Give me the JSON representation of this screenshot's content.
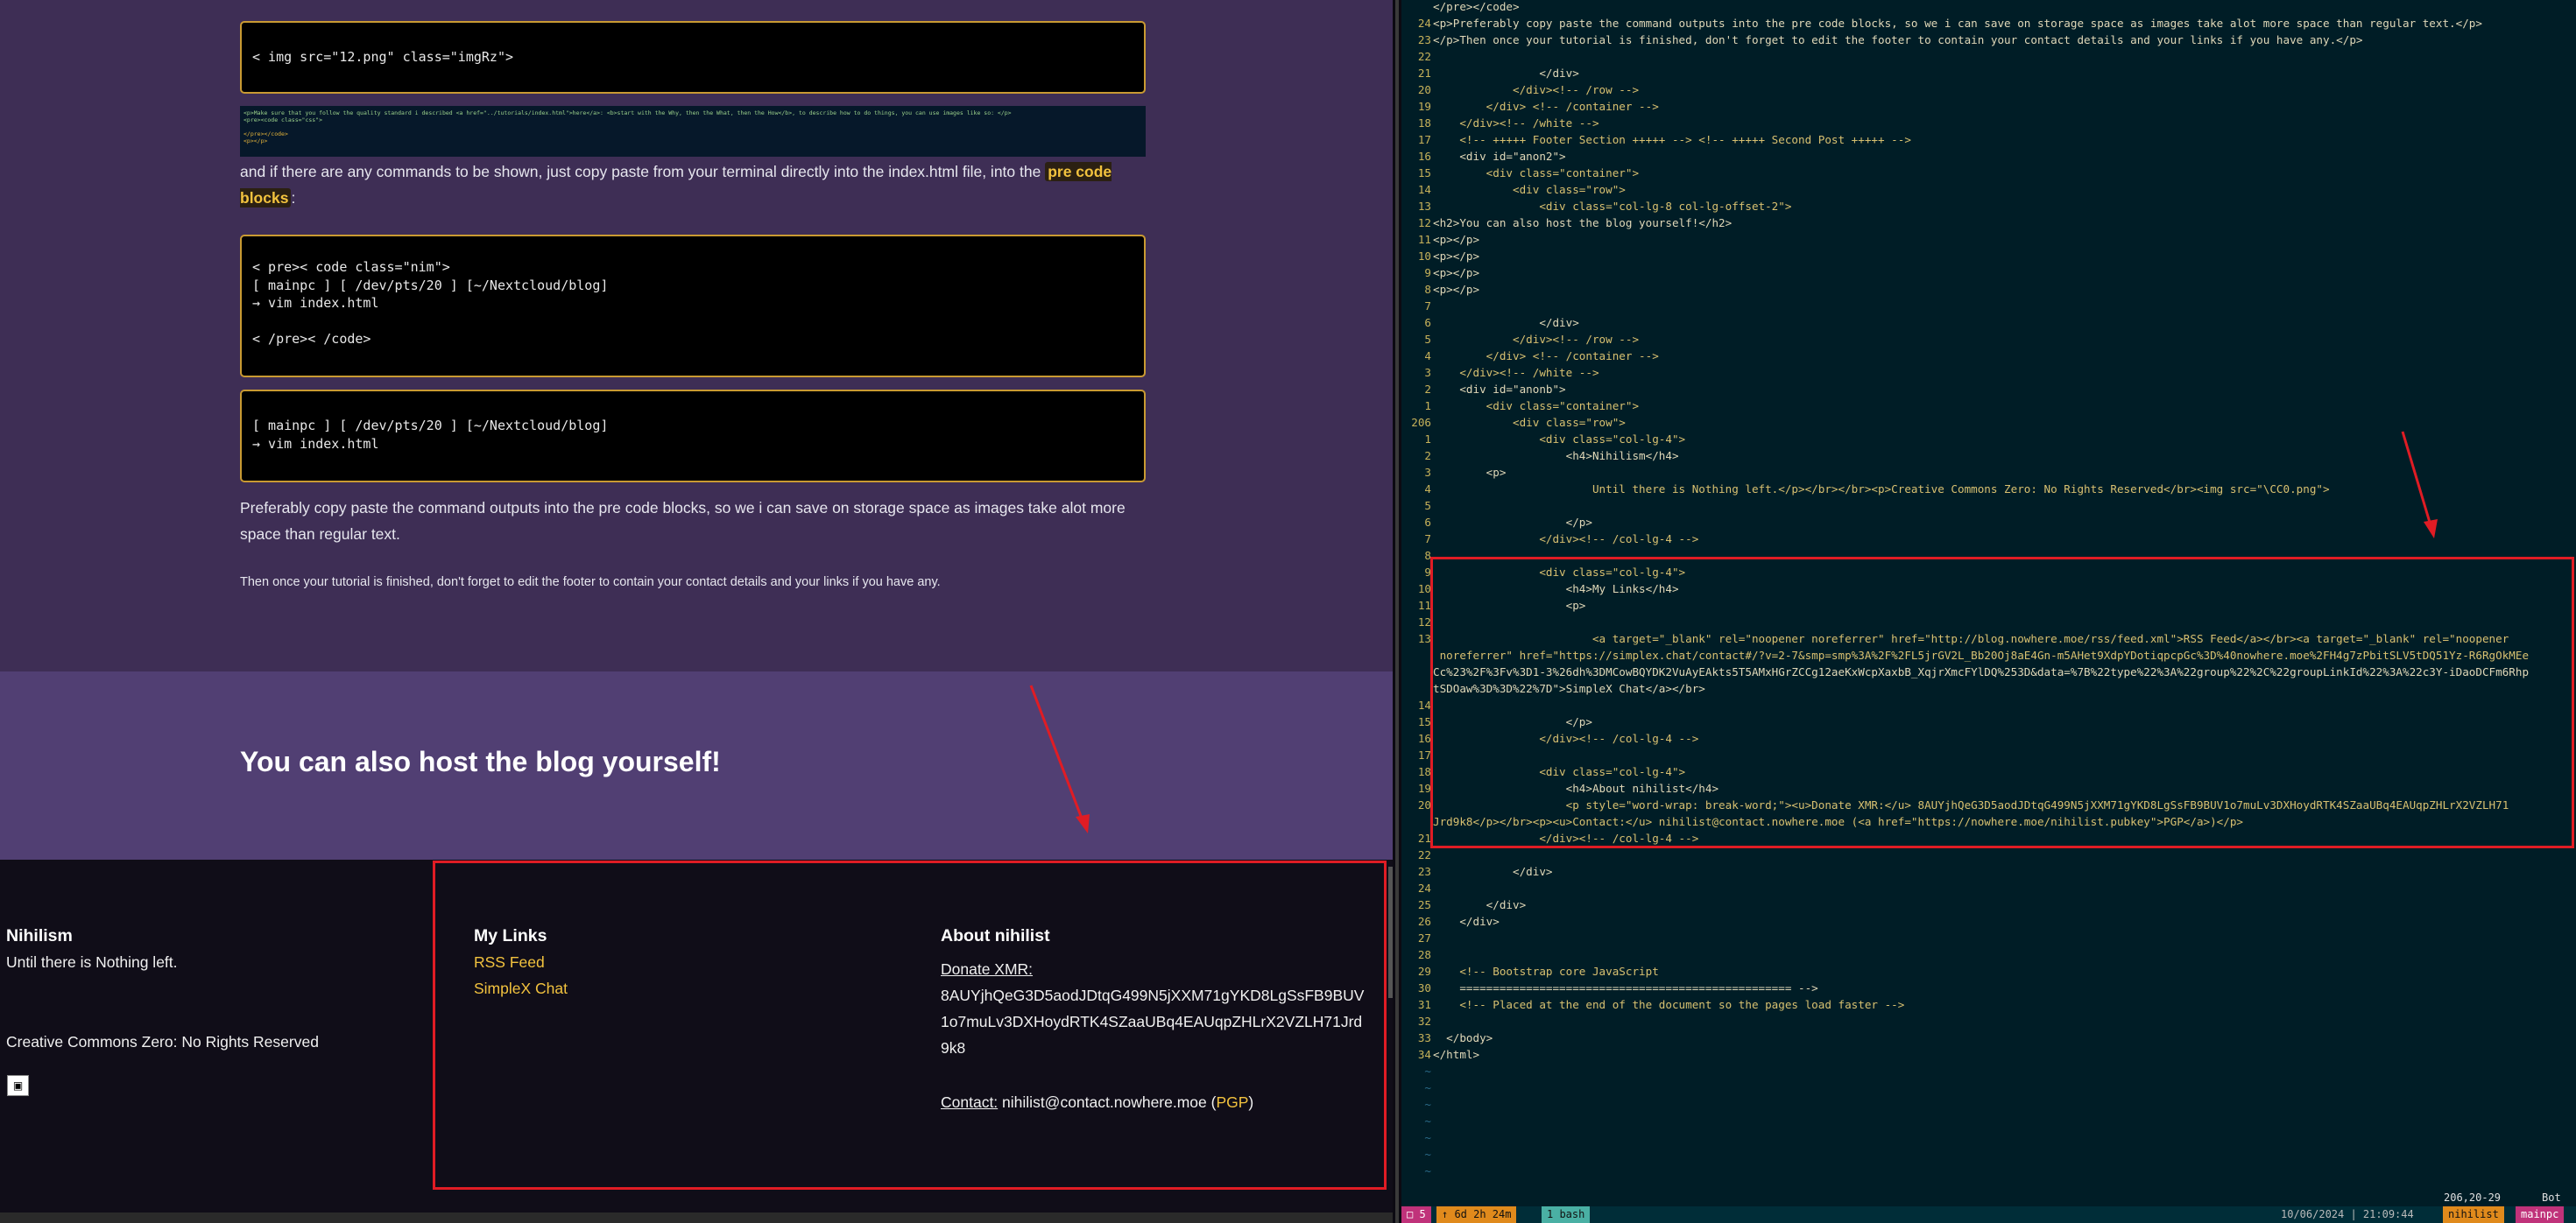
{
  "browser": {
    "code1": "< img src=\"12.png\" class=\"imgRz\">",
    "thumb_line1": "<p>Make sure that you follow the quality standard i described <a href=\"../tutorials/index.html\">here</a>: <b>start with the Why, then the What, then the How</b>, to describe how to do things, you can use images like so: </p>",
    "thumb_line2": "<pre><code class=\"css\">",
    "thumb_line3": "</pre></code>",
    "thumb_line4": "<p></p>",
    "para1_pre": "and if there are any commands to be shown, just copy paste from your terminal directly into the index.html file, into the ",
    "para1_hl": "pre code blocks",
    "para1_post": ":",
    "code2": "< pre>< code class=\"nim\">\n[ mainpc ] [ /dev/pts/20 ] [~/Nextcloud/blog]\n→ vim index.html\n\n< /pre>< /code>",
    "code3": "[ mainpc ] [ /dev/pts/20 ] [~/Nextcloud/blog]\n→ vim index.html",
    "para2": "Preferably copy paste the command outputs into the pre code blocks, so we i can save on storage space as images take alot more space than regular text.",
    "para3": "Then once your tutorial is finished, don't forget to edit the footer to contain your contact details and your links if you have any.",
    "section_title": "You can also host the blog yourself!",
    "footer": {
      "col1_title": "Nihilism",
      "col1_text": "Until there is Nothing left.",
      "col1_license": "Creative Commons Zero: No Rights Reserved",
      "col2_title": "My Links",
      "link_rss": "RSS Feed",
      "link_simplex": "SimpleX Chat",
      "col3_title": "About nihilist",
      "xmr_label": "Donate XMR:",
      "xmr_l1": "8AUYjhQeG3D5aodJDtqG499N5jXXM71gYKD8LgSsFB9BUV",
      "xmr_l2": "1o7muLv3DXHoydRTK4SZaaUBq4EAUqpZHLrX2VZLH71Jrd",
      "xmr_l3": "9k8",
      "contact_label": "Contact:",
      "contact_email": " nihilist@contact.nowhere.moe (",
      "contact_pgp": "PGP",
      "contact_end": ")"
    }
  },
  "editor": {
    "lines": [
      {
        "n": "",
        "t": "</pre></code>"
      },
      {
        "n": "24",
        "t": "<p>Preferably copy paste the command outputs into the pre code blocks, so we i can save on storage space as images take alot more space than regular text.</p>"
      },
      {
        "n": "23",
        "t": "</p>Then once your tutorial is finished, don't forget to edit the footer to contain your contact details and your links if you have any.</p>"
      },
      {
        "n": "22",
        "t": ""
      },
      {
        "n": "21",
        "t": "                </div>"
      },
      {
        "n": "20",
        "t": "            </div><!-- /row -->"
      },
      {
        "n": "19",
        "t": "        </div> <!-- /container -->"
      },
      {
        "n": "18",
        "t": "    </div><!-- /white -->"
      },
      {
        "n": "17",
        "t": "    <!-- +++++ Footer Section +++++ --> <!-- +++++ Second Post +++++ -->"
      },
      {
        "n": "16",
        "t": "    <div id=\"anon2\">"
      },
      {
        "n": "15",
        "t": "        <div class=\"container\">"
      },
      {
        "n": "14",
        "t": "            <div class=\"row\">"
      },
      {
        "n": "13",
        "t": "                <div class=\"col-lg-8 col-lg-offset-2\">"
      },
      {
        "n": "12",
        "t": "<h2>You can also host the blog yourself!</h2>"
      },
      {
        "n": "11",
        "t": "<p></p>"
      },
      {
        "n": "10",
        "t": "<p></p>"
      },
      {
        "n": "9",
        "t": "<p></p>"
      },
      {
        "n": "8",
        "t": "<p></p>"
      },
      {
        "n": "7",
        "t": ""
      },
      {
        "n": "6",
        "t": "                </div>"
      },
      {
        "n": "5",
        "t": "            </div><!-- /row -->"
      },
      {
        "n": "4",
        "t": "        </div> <!-- /container -->"
      },
      {
        "n": "3",
        "t": "    </div><!-- /white -->"
      },
      {
        "n": "2",
        "t": "    <div id=\"anonb\">"
      },
      {
        "n": "1",
        "t": "        <div class=\"container\">"
      },
      {
        "n": "206",
        "t": "            <div class=\"row\">"
      },
      {
        "n": "1",
        "t": "                <div class=\"col-lg-4\">"
      },
      {
        "n": "2",
        "t": "                    <h4>Nihilism</h4>"
      },
      {
        "n": "3",
        "t": "        <p>"
      },
      {
        "n": "4",
        "t": "                        Until there is Nothing left.</p></br></br><p>Creative Commons Zero: No Rights Reserved</br><img src=\"\\CC0.png\">"
      },
      {
        "n": "5",
        "t": ""
      },
      {
        "n": "6",
        "t": "                    </p>"
      },
      {
        "n": "7",
        "t": "                </div><!-- /col-lg-4 -->"
      },
      {
        "n": "8",
        "t": ""
      },
      {
        "n": "9",
        "t": "                <div class=\"col-lg-4\">"
      },
      {
        "n": "10",
        "t": "                    <h4>My Links</h4>"
      },
      {
        "n": "11",
        "t": "                    <p>"
      },
      {
        "n": "12",
        "t": ""
      },
      {
        "n": "13",
        "t": "                        <a target=\"_blank\" rel=\"noopener noreferrer\" href=\"http://blog.nowhere.moe/rss/feed.xml\">RSS Feed</a></br><a target=\"_blank\" rel=\"noopener"
      },
      {
        "n": "",
        "t": " noreferrer\" href=\"https://simplex.chat/contact#/?v=2-7&smp=smp%3A%2F%2FL5jrGV2L_Bb20Oj8aE4Gn-m5AHet9XdpYDotiqpcpGc%3D%40nowhere.moe%2FH4g7zPbitSLV5tDQ51Yz-R6RgOkMEeCc%23%2F%3Fv%3D1-3%26dh%3DMCowBQYDK2VuAyEAkts5T5AMxHGrZCCg12aeKxWcpXaxbB_XqjrXmcFYlDQ%253D&data=%7B%22type%22%3A%22group%22%2C%22groupLinkId%22%3A%22c3Y-iDaoDCFm6RhptSDOaw%3D%3D%22%7D\">SimpleX Chat</a></br>"
      },
      {
        "n": "14",
        "t": ""
      },
      {
        "n": "15",
        "t": "                    </p>"
      },
      {
        "n": "16",
        "t": "                </div><!-- /col-lg-4 -->"
      },
      {
        "n": "17",
        "t": ""
      },
      {
        "n": "18",
        "t": "                <div class=\"col-lg-4\">"
      },
      {
        "n": "19",
        "t": "                    <h4>About nihilist</h4>"
      },
      {
        "n": "20",
        "t": "                    <p style=\"word-wrap: break-word;\"><u>Donate XMR:</u> 8AUYjhQeG3D5aodJDtqG499N5jXXM71gYKD8LgSsFB9BUV1o7muLv3DXHoydRTK4SZaaUBq4EAUqpZHLrX2VZLH71"
      },
      {
        "n": "",
        "t": "Jrd9k8</p></br><p><u>Contact:</u> nihilist@contact.nowhere.moe (<a href=\"https://nowhere.moe/nihilist.pubkey\">PGP</a>)</p>"
      },
      {
        "n": "21",
        "t": "                </div><!-- /col-lg-4 -->"
      },
      {
        "n": "22",
        "t": ""
      },
      {
        "n": "23",
        "t": "            </div>"
      },
      {
        "n": "24",
        "t": ""
      },
      {
        "n": "25",
        "t": "        </div>"
      },
      {
        "n": "26",
        "t": "    </div>"
      },
      {
        "n": "27",
        "t": ""
      },
      {
        "n": "28",
        "t": ""
      },
      {
        "n": "29",
        "t": "    <!-- Bootstrap core JavaScript"
      },
      {
        "n": "30",
        "t": "    ================================================== -->"
      },
      {
        "n": "31",
        "t": "    <!-- Placed at the end of the document so the pages load faster -->"
      },
      {
        "n": "32",
        "t": ""
      },
      {
        "n": "33",
        "t": "  </body>"
      },
      {
        "n": "34",
        "t": "</html>"
      },
      {
        "n": "~",
        "t": ""
      },
      {
        "n": "~",
        "t": ""
      },
      {
        "n": "~",
        "t": ""
      },
      {
        "n": "~",
        "t": ""
      },
      {
        "n": "~",
        "t": ""
      },
      {
        "n": "~",
        "t": ""
      },
      {
        "n": "~",
        "t": ""
      }
    ],
    "position": "206,20-29",
    "position_pct": "Bot"
  },
  "statusbar": {
    "session": "5",
    "uptime": "6d 2h 24m",
    "window": "1 bash",
    "datetime": "10/06/2024 | 21:09:44",
    "user": "nihilist",
    "host": "mainpc"
  },
  "colors": {
    "accent": "#f2c23e",
    "highlight_box": "#e01c24",
    "editor_bg": "#001d26"
  }
}
